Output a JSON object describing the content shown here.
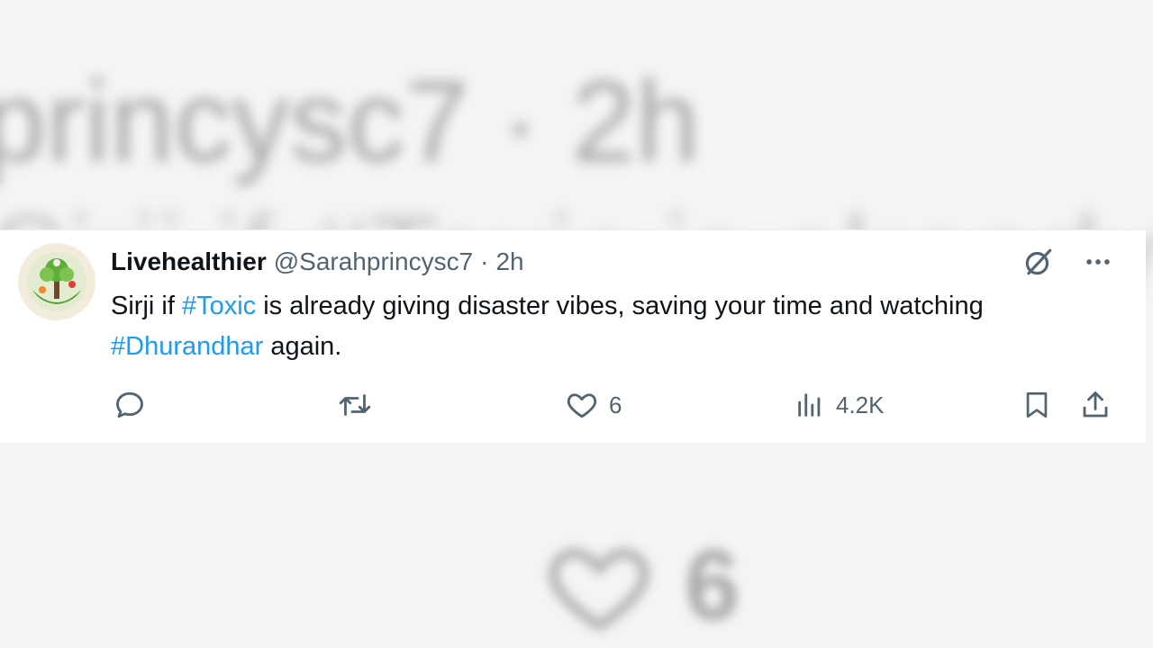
{
  "background": {
    "handle_blur": "princysc7 · 2h",
    "text_blur": "Sirji if #Toxic is already",
    "like_count_blur": "6"
  },
  "tweet": {
    "display_name": "Livehealthier",
    "handle": "@Sarahprincysc7",
    "separator": "·",
    "time": "2h",
    "text_parts": {
      "t1": "Sirji  if ",
      "tag1": "#Toxic",
      "t2": " is already giving disaster vibes, saving your time and watching ",
      "tag2": "#Dhurandhar",
      "t3": " again."
    },
    "icons": {
      "grok": "grok-icon",
      "more": "more-icon"
    }
  },
  "actions": {
    "reply": {
      "icon": "reply-icon",
      "count": ""
    },
    "repost": {
      "icon": "repost-icon",
      "count": ""
    },
    "like": {
      "icon": "heart-icon",
      "count": "6"
    },
    "views": {
      "icon": "views-icon",
      "count": "4.2K"
    },
    "bookmark": {
      "icon": "bookmark-icon"
    },
    "share": {
      "icon": "share-icon"
    }
  },
  "colors": {
    "hashtag": "#1d9bf0",
    "text": "#0f1419",
    "muted": "#536471"
  }
}
